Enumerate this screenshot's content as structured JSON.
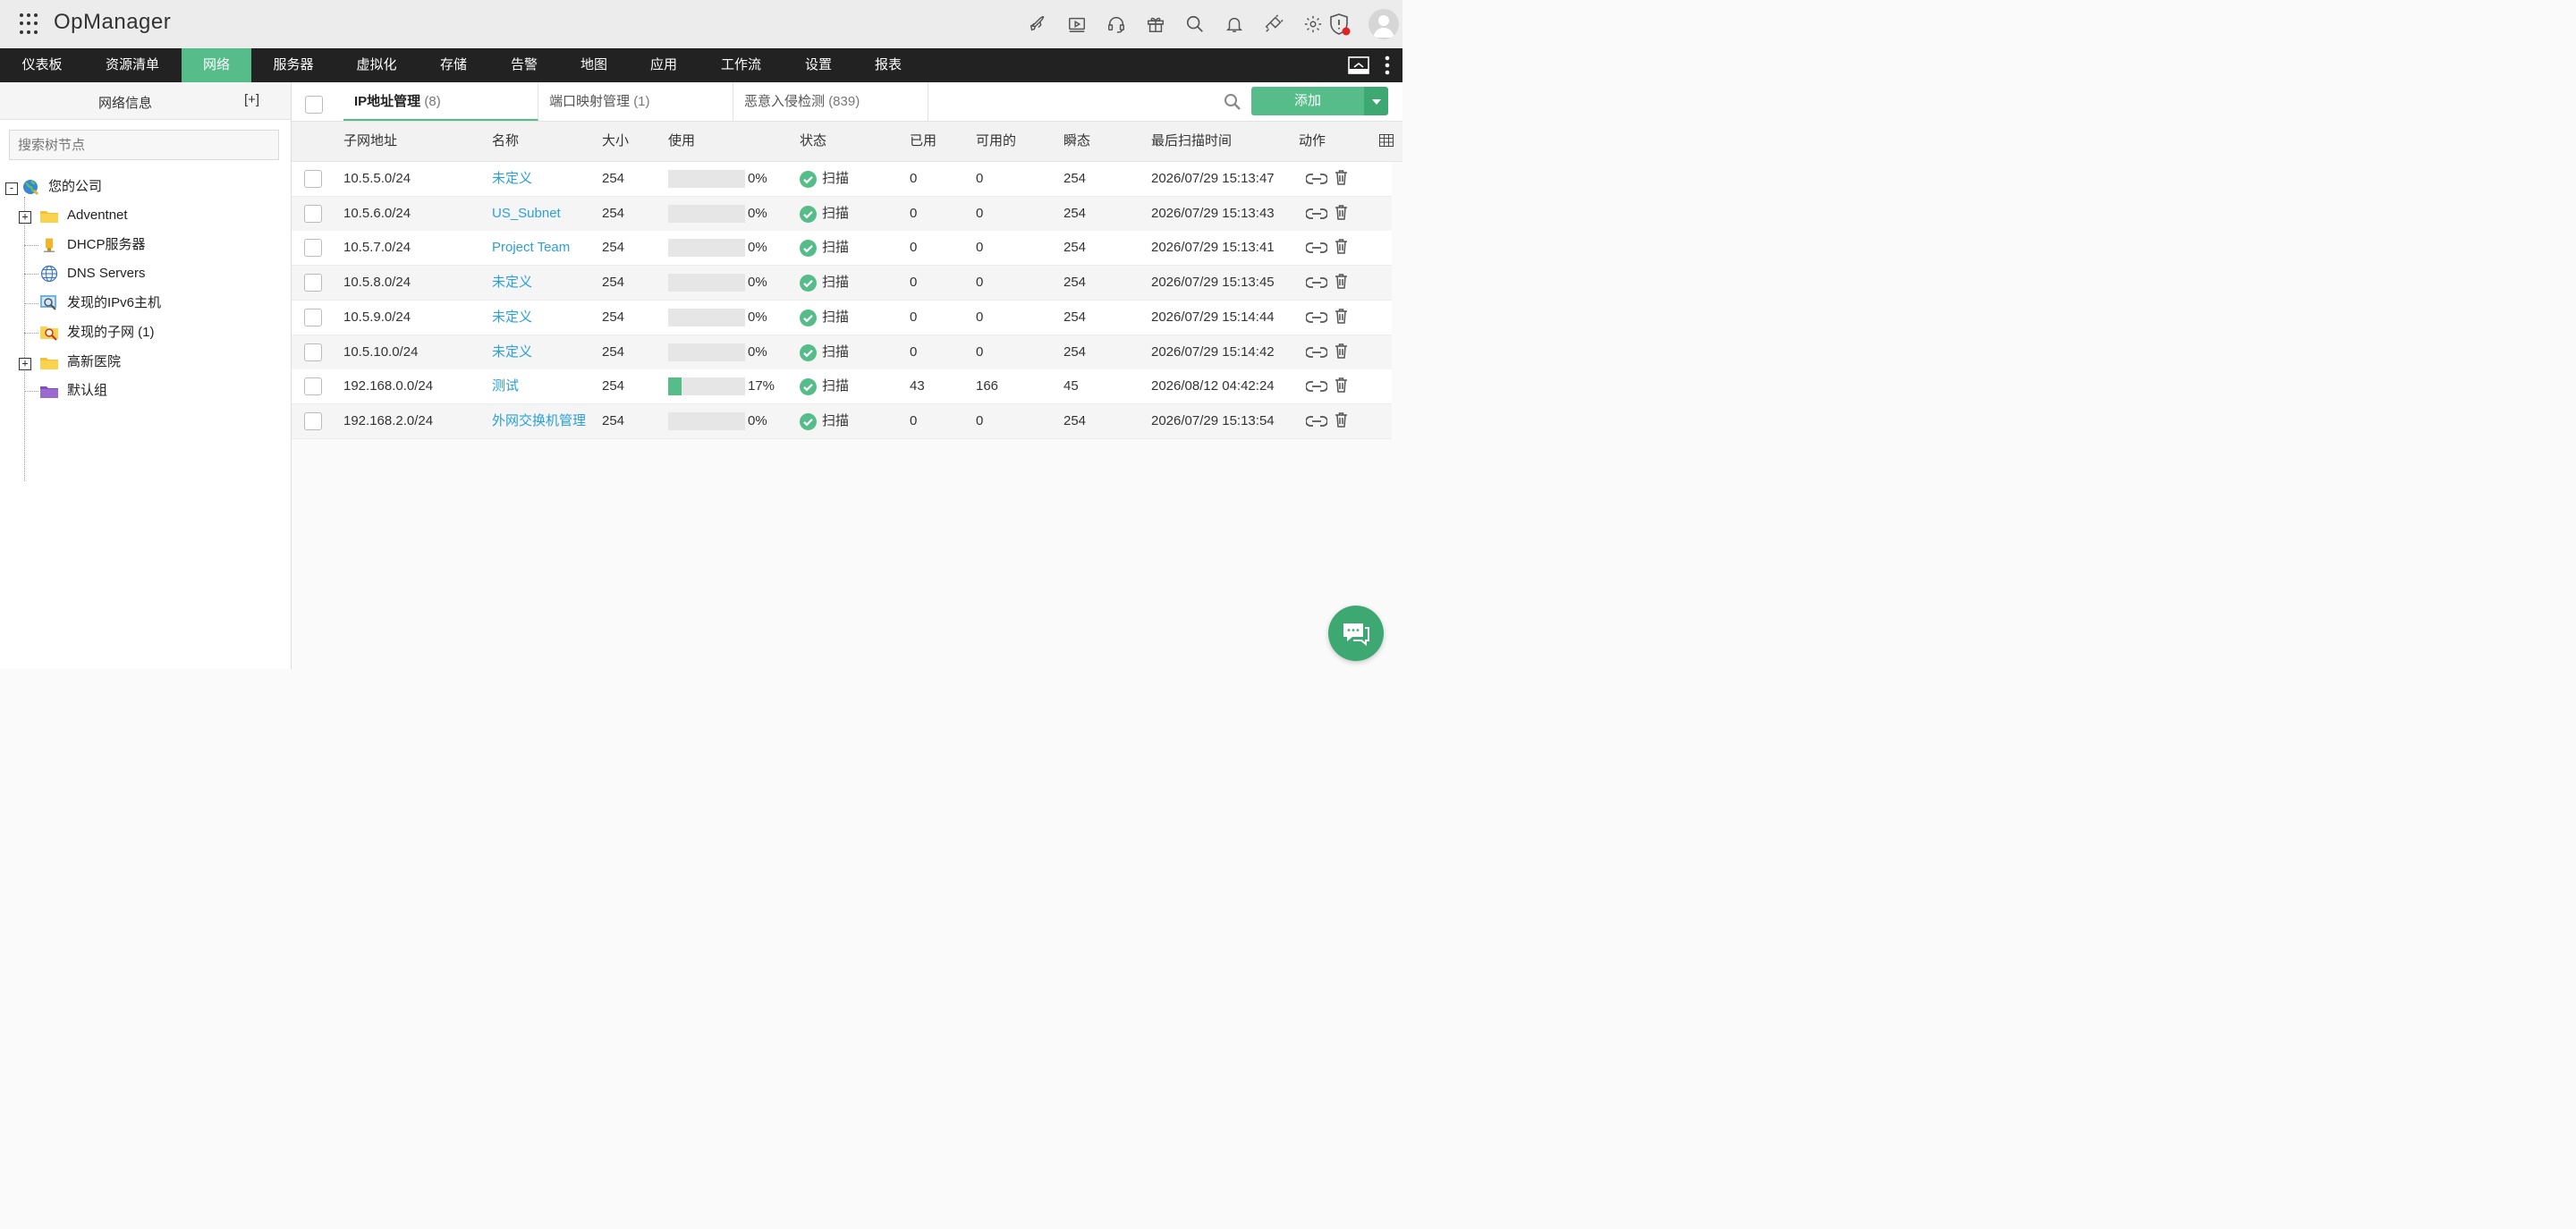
{
  "app": {
    "title": "OpManager"
  },
  "nav": {
    "items": [
      {
        "label": "仪表板",
        "active": false
      },
      {
        "label": "资源清单",
        "active": false
      },
      {
        "label": "网络",
        "active": true
      },
      {
        "label": "服务器",
        "active": false
      },
      {
        "label": "虚拟化",
        "active": false
      },
      {
        "label": "存储",
        "active": false
      },
      {
        "label": "告警",
        "active": false
      },
      {
        "label": "地图",
        "active": false
      },
      {
        "label": "应用",
        "active": false
      },
      {
        "label": "工作流",
        "active": false
      },
      {
        "label": "设置",
        "active": false
      },
      {
        "label": "报表",
        "active": false
      }
    ]
  },
  "sidebar": {
    "title": "网络信息",
    "add_label": "[+]",
    "search_placeholder": "搜索树节点",
    "tree": {
      "root": {
        "label": "您的公司",
        "toggle": "-"
      },
      "children": [
        {
          "label": "Adventnet",
          "toggle": "+",
          "icon": "folder-icon"
        },
        {
          "label": "DHCP服务器",
          "icon": "dhcp-server-icon"
        },
        {
          "label": "DNS Servers",
          "icon": "globe-icon"
        },
        {
          "label": "发现的IPv6主机",
          "icon": "search-host-icon"
        },
        {
          "label": "发现的子网 (1)",
          "icon": "search-folder-icon"
        },
        {
          "label": "高新医院",
          "toggle": "+",
          "icon": "folder-icon"
        },
        {
          "label": "默认组",
          "icon": "purple-folder-icon"
        }
      ]
    }
  },
  "tabs": [
    {
      "label": "IP地址管理",
      "count": "(8)",
      "active": true
    },
    {
      "label": "端口映射管理",
      "count": "(1)",
      "active": false
    },
    {
      "label": "恶意入侵检测",
      "count": "(839)",
      "active": false
    }
  ],
  "add_button": {
    "label": "添加"
  },
  "table": {
    "headers": [
      "子网地址",
      "名称",
      "大小",
      "使用",
      "状态",
      "已用",
      "可用的",
      "瞬态",
      "最后扫描时间",
      "动作"
    ],
    "rows": [
      {
        "subnet": "10.5.5.0/24",
        "name": "未定义",
        "size": "254",
        "usage_pct": 0,
        "usage": "0%",
        "status": "扫描",
        "used": "0",
        "available": "0",
        "transient": "254",
        "last_scan": "2026/07/29 15:13:47"
      },
      {
        "subnet": "10.5.6.0/24",
        "name": "US_Subnet",
        "size": "254",
        "usage_pct": 0,
        "usage": "0%",
        "status": "扫描",
        "used": "0",
        "available": "0",
        "transient": "254",
        "last_scan": "2026/07/29 15:13:43"
      },
      {
        "subnet": "10.5.7.0/24",
        "name": "Project Team",
        "size": "254",
        "usage_pct": 0,
        "usage": "0%",
        "status": "扫描",
        "used": "0",
        "available": "0",
        "transient": "254",
        "last_scan": "2026/07/29 15:13:41"
      },
      {
        "subnet": "10.5.8.0/24",
        "name": "未定义",
        "size": "254",
        "usage_pct": 0,
        "usage": "0%",
        "status": "扫描",
        "used": "0",
        "available": "0",
        "transient": "254",
        "last_scan": "2026/07/29 15:13:45"
      },
      {
        "subnet": "10.5.9.0/24",
        "name": "未定义",
        "size": "254",
        "usage_pct": 0,
        "usage": "0%",
        "status": "扫描",
        "used": "0",
        "available": "0",
        "transient": "254",
        "last_scan": "2026/07/29 15:14:44"
      },
      {
        "subnet": "10.5.10.0/24",
        "name": "未定义",
        "size": "254",
        "usage_pct": 0,
        "usage": "0%",
        "status": "扫描",
        "used": "0",
        "available": "0",
        "transient": "254",
        "last_scan": "2026/07/29 15:14:42"
      },
      {
        "subnet": "192.168.0.0/24",
        "name": "测试",
        "size": "254",
        "usage_pct": 17,
        "usage": "17%",
        "status": "扫描",
        "used": "43",
        "available": "166",
        "transient": "45",
        "last_scan": "2026/08/12 04:42:24"
      },
      {
        "subnet": "192.168.2.0/24",
        "name": "外网交换机管理",
        "size": "254",
        "usage_pct": 0,
        "usage": "0%",
        "status": "扫描",
        "used": "0",
        "available": "0",
        "transient": "254",
        "last_scan": "2026/07/29 15:13:54"
      }
    ]
  },
  "colors": {
    "accent": "#56bd8a",
    "link": "#2a9fd8",
    "navbar": "#222222",
    "topbar": "#ececec",
    "alert_dot": "#e02424"
  },
  "icons": {
    "top": [
      "rocket-icon",
      "video-icon",
      "headset-icon",
      "gift-icon",
      "search-icon",
      "bell-icon",
      "plugin-icon",
      "gear-icon"
    ],
    "status": "check-circle-icon",
    "actions": [
      "link-icon",
      "trash-icon"
    ]
  }
}
